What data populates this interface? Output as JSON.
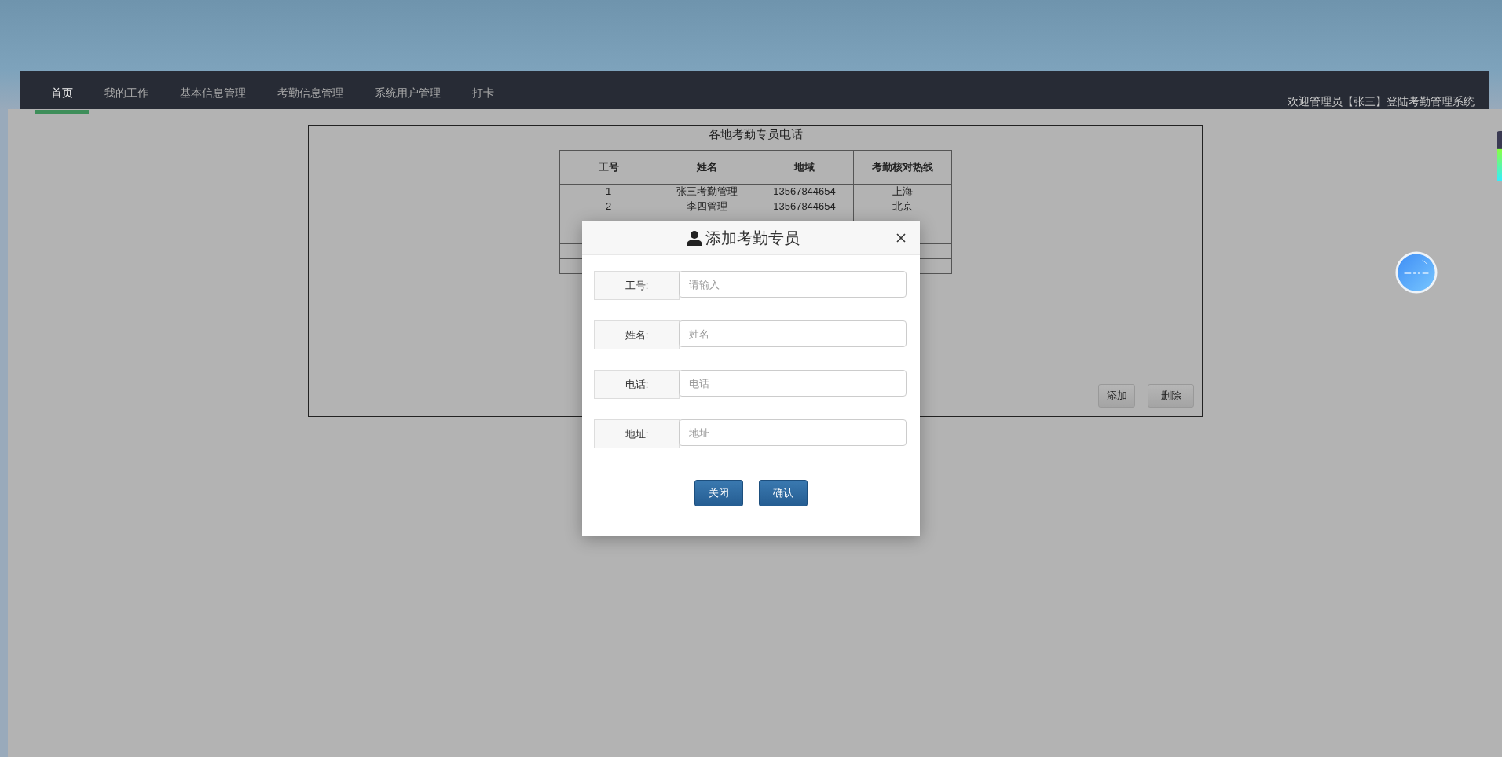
{
  "nav": {
    "tabs": [
      {
        "label": "首页",
        "selected": true
      },
      {
        "label": "我的工作",
        "selected": false
      },
      {
        "label": "基本信息管理",
        "selected": false
      },
      {
        "label": "考勤信息管理",
        "selected": false
      },
      {
        "label": "系统用户管理",
        "selected": false
      },
      {
        "label": "打卡",
        "selected": false
      }
    ],
    "welcome": "欢迎管理员【张三】登陆考勤管理系统"
  },
  "panel": {
    "title": "各地考勤专员电话",
    "table": {
      "columns": [
        "工号",
        "姓名",
        "地域",
        "考勤核对热线"
      ],
      "rows": [
        [
          "1",
          "张三考勤管理",
          "13567844654",
          "上海"
        ],
        [
          "2",
          "李四管理",
          "13567844654",
          "北京"
        ]
      ]
    },
    "buttons": [
      "添加",
      "删除"
    ]
  },
  "modal": {
    "title": "添加考勤专员",
    "fields": [
      {
        "label": "工号:",
        "placeholder": "请输入"
      },
      {
        "label": "姓名:",
        "placeholder": "姓名"
      },
      {
        "label": "电话:",
        "placeholder": "电话"
      },
      {
        "label": "地址:",
        "placeholder": "地址"
      }
    ],
    "buttons": [
      "关闭",
      "确认"
    ]
  }
}
